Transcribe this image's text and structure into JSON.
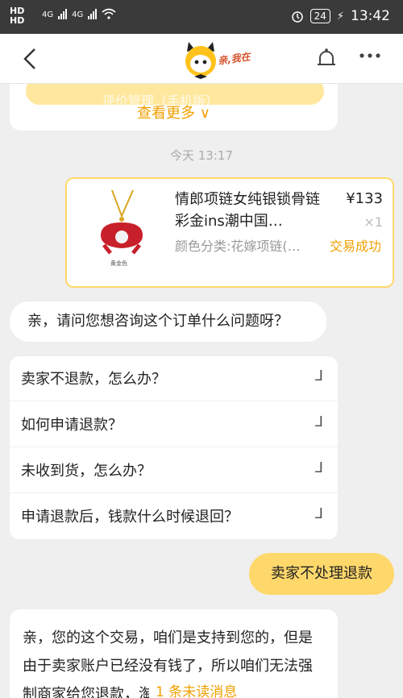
{
  "status_bar": {
    "network_left": "HD",
    "network_left2": "HD",
    "signal1": "4G",
    "signal2": "4G",
    "battery": "24",
    "time": "13:42"
  },
  "nav": {
    "logo_text": "亲,我在"
  },
  "top_card": {
    "ghost_text": "评价管理（手机版）",
    "more_label": "查看更多 ∨"
  },
  "timestamp": "今天 13:17",
  "order": {
    "title": "情郎项链女纯银锁骨链彩金ins潮中国…",
    "price": "¥133",
    "qty": "×1",
    "spec": "颜色分类:花嫁项链(…",
    "status": "交易成功",
    "image_caption": "黄金色"
  },
  "question_bubble": "亲，请问您想咨询这个订单什么问题呀？",
  "faq": [
    {
      "label": "卖家不退款，怎么办？"
    },
    {
      "label": "如何申请退款？"
    },
    {
      "label": "未收到货，怎么办？"
    },
    {
      "label": "申请退款后，钱款什么时候退回？"
    }
  ],
  "my_message": "卖家不处理退款",
  "answer": {
    "text": "亲，您的这个交易，咱们是支持到您的，但是由于卖家账户已经没有钱了，所以咱们无法强制商家给您退款，淘宝网已经"
  },
  "unread_label": "1 条未读消息",
  "colors": {
    "accent": "#ffd86b",
    "link": "#f0a000",
    "status_bar": "#3a3a3a"
  }
}
